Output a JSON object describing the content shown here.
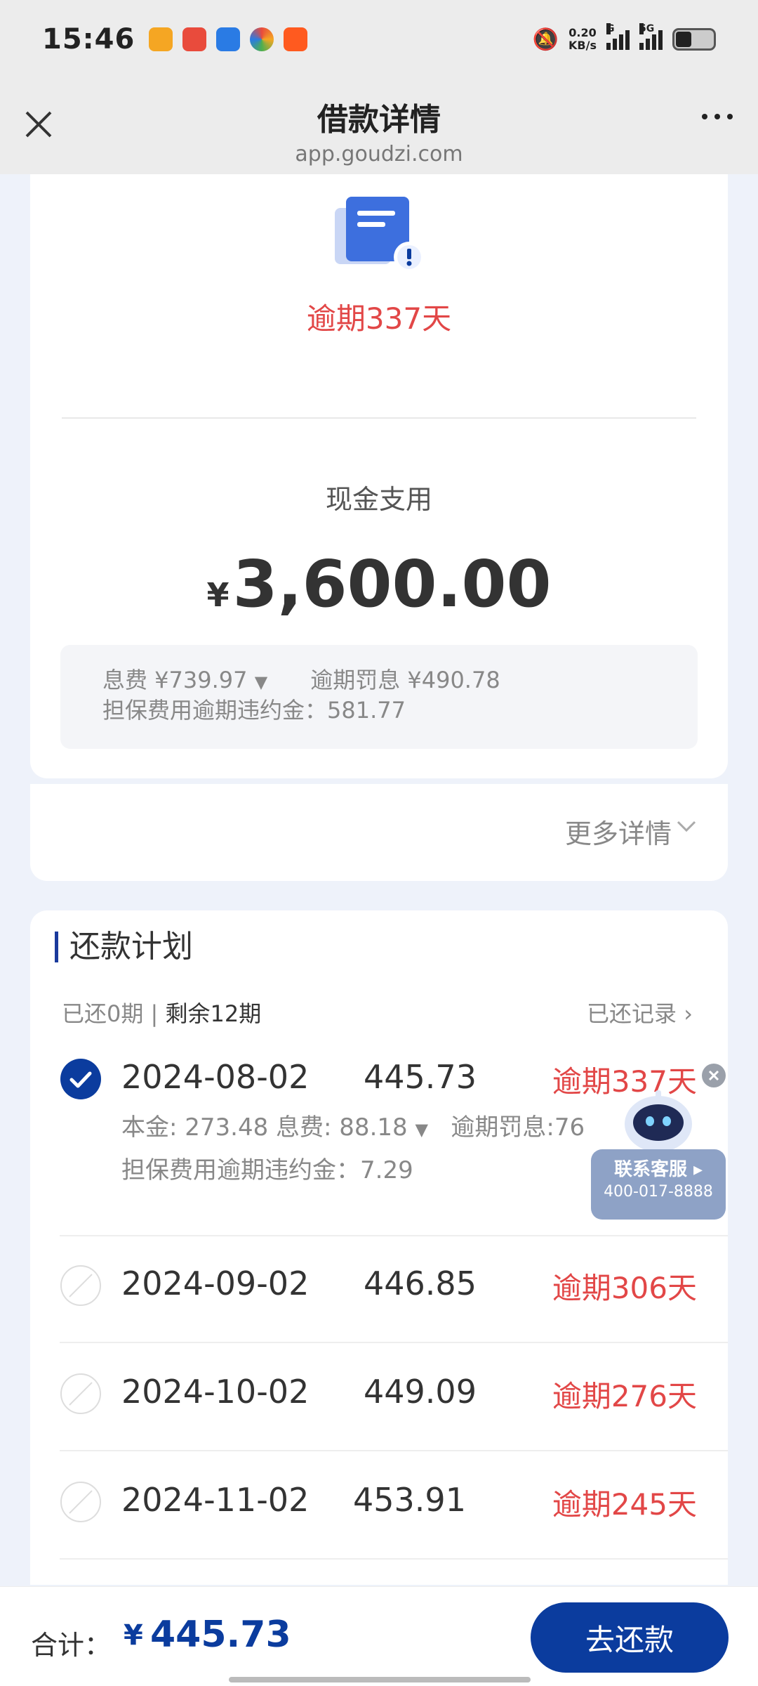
{
  "status_bar": {
    "time": "15:46",
    "net_speed_value": "0.20",
    "net_speed_unit": "KB/s",
    "sim1_label": "G",
    "sim2_label": "5G"
  },
  "nav": {
    "title": "借款详情",
    "url": "app.goudzi.com"
  },
  "summary": {
    "overdue": "逾期337天",
    "cash_label": "现金支用",
    "currency": "¥",
    "amount": "3,600.00",
    "interest": "息费 ¥739.97",
    "penalty": "逾期罚息 ¥490.78",
    "guarantee_fee": "担保费用逾期违约金：581.77"
  },
  "more": {
    "label": "更多详情"
  },
  "plan": {
    "title": "还款计划",
    "paid": "已还0期",
    "remaining": "剩余12期",
    "record": "已还记录",
    "rows": [
      {
        "date": "2024-08-02",
        "amount": "445.73",
        "status": "逾期337天",
        "checked": true,
        "detail1": "本金: 273.48   息费: 88.18",
        "detail1b": "逾期罚息:76",
        "detail2": "担保费用逾期违约金：7.29"
      },
      {
        "date": "2024-09-02",
        "amount": "446.85",
        "status": "逾期306天",
        "checked": false
      },
      {
        "date": "2024-10-02",
        "amount": "449.09",
        "status": "逾期276天",
        "checked": false
      },
      {
        "date": "2024-11-02",
        "amount": "453.91",
        "status": "逾期245天",
        "checked": false
      }
    ]
  },
  "service": {
    "line1": "联系客服",
    "line2": "400-017-8888"
  },
  "footer": {
    "total_label": "合计：",
    "currency": "¥",
    "total": "445.73",
    "pay_button": "去还款"
  },
  "colors": {
    "accent": "#0b3c9e",
    "overdue": "#e24747"
  }
}
